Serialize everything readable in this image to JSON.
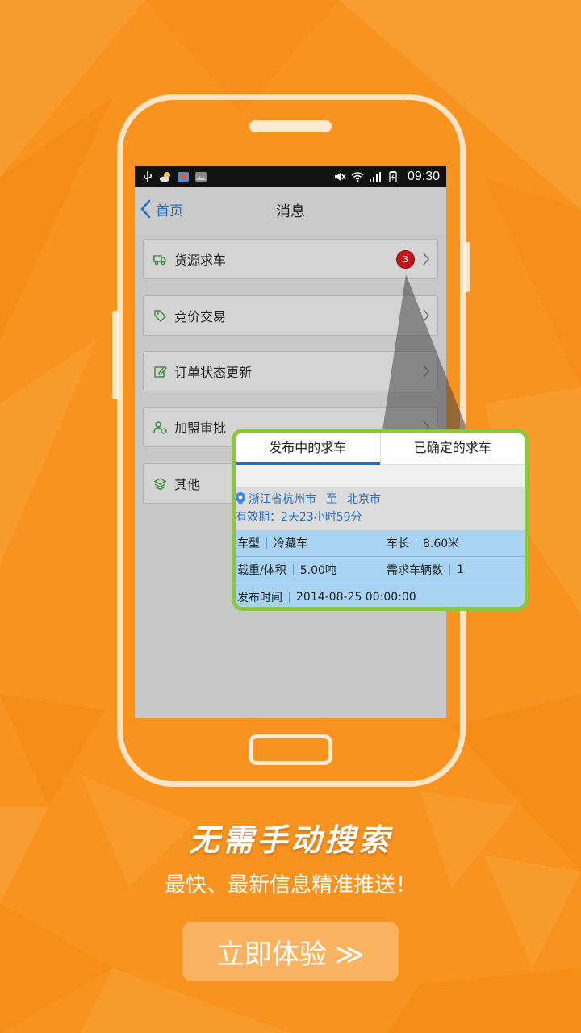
{
  "colors": {
    "background": "#f7931e",
    "accent_blue": "#1e6fd0",
    "badge_red": "#c4161c",
    "popup_border": "#8cc63f",
    "detail_blue": "#a8d4f2"
  },
  "status_bar": {
    "time": "09:30",
    "left_icons": [
      "usb-icon",
      "weather-icon",
      "app-icon",
      "image-icon"
    ],
    "right_icons": [
      "mute-icon",
      "wifi-icon",
      "signal-icon",
      "battery-icon"
    ]
  },
  "header": {
    "back_label": "首页",
    "title": "消息"
  },
  "menu": {
    "items": [
      {
        "label": "货源求车",
        "icon": "truck-icon",
        "badge": "3"
      },
      {
        "label": "竞价交易",
        "icon": "tag-icon"
      },
      {
        "label": "订单状态更新",
        "icon": "edit-icon"
      },
      {
        "label": "加盟审批",
        "icon": "user-check-icon"
      },
      {
        "label": "其他",
        "icon": "layers-icon"
      }
    ]
  },
  "popup": {
    "tabs": [
      "发布中的求车",
      "已确定的求车"
    ],
    "route": {
      "from": "浙江省杭州市",
      "sep": "至",
      "to": "北京市",
      "validity": "有效期：2天23小时59分"
    },
    "details": {
      "vehicle_type_label": "车型",
      "vehicle_type": "冷藏车",
      "length_label": "车长",
      "length": "8.60米",
      "capacity_label": "载重/体积",
      "capacity": "5.00吨",
      "count_label": "需求车辆数",
      "count": "1",
      "time_label": "发布时间",
      "time": "2014-08-25  00:00:00"
    }
  },
  "promo": {
    "headline": "无需手动搜索",
    "subline": "最快、最新信息精准推送！",
    "cta": "立即体验 ≫"
  }
}
